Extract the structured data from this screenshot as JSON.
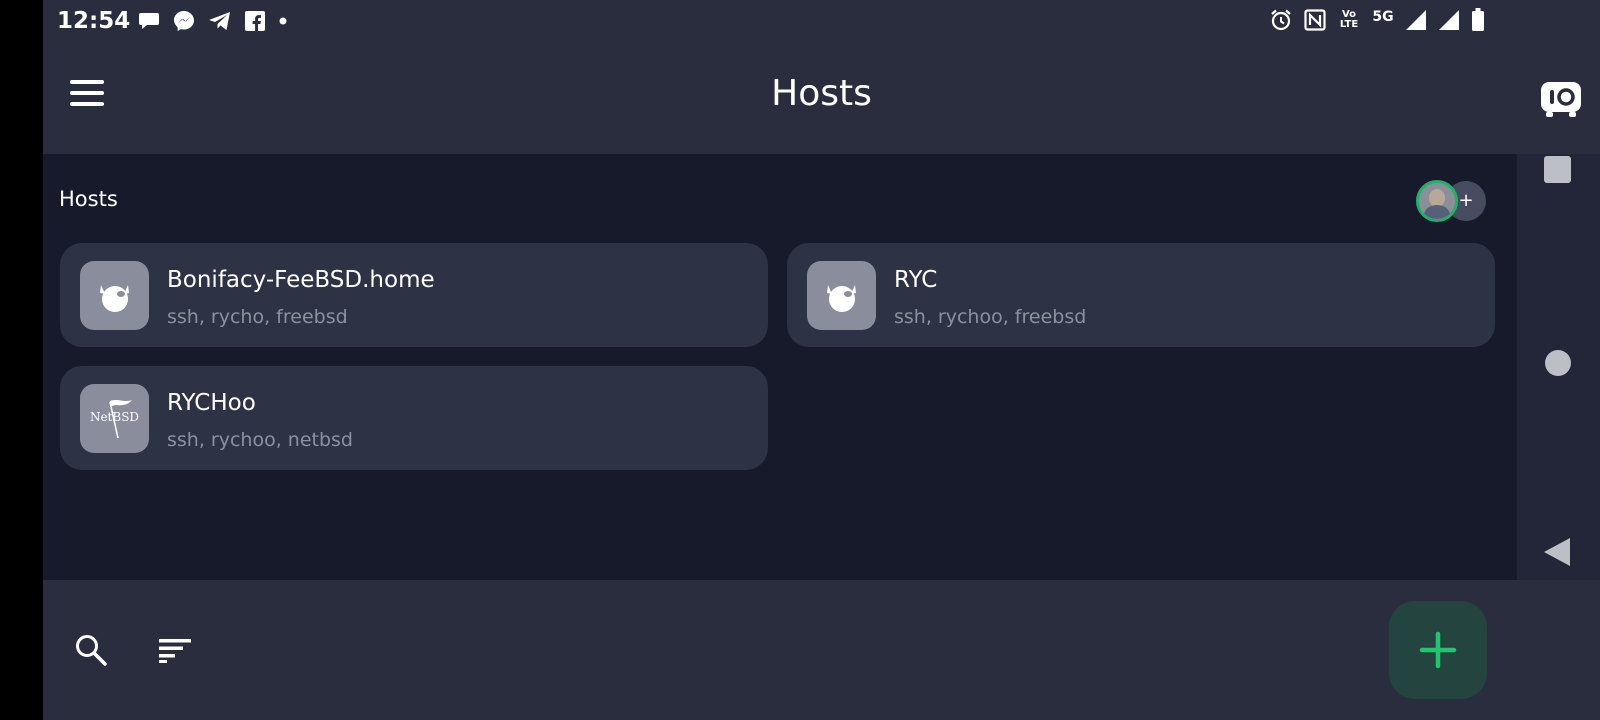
{
  "status_bar": {
    "time": "12:54",
    "left_icons": [
      "chat-bubble-icon",
      "messenger-icon",
      "telegram-icon",
      "facebook-icon",
      "dot-icon"
    ],
    "right_icons": [
      "alarm-icon",
      "nfc-icon",
      "volte-icon",
      "5g-icon",
      "signal-icon",
      "signal-icon",
      "battery-icon"
    ],
    "volte_text_top": "Vo",
    "volte_text_bottom": "LTE",
    "network_text": "5G"
  },
  "app_bar": {
    "title": "Hosts",
    "menu_icon": "hamburger-menu-icon",
    "vault_icon": "vault-icon"
  },
  "section": {
    "title": "Hosts",
    "add_member_label": "+"
  },
  "hosts": [
    {
      "name": "Bonifacy-FeeBSD.home",
      "tags": "ssh, rycho, freebsd",
      "os_icon": "freebsd-icon"
    },
    {
      "name": "RYC",
      "tags": "ssh, rychoo, freebsd",
      "os_icon": "freebsd-icon"
    },
    {
      "name": "RYCHoo",
      "tags": "ssh, rychoo, netbsd",
      "os_icon": "netbsd-icon",
      "logo_text": "NetBSD"
    }
  ],
  "bottom_bar": {
    "search_icon": "search-icon",
    "sort_icon": "sort-icon",
    "fab_icon": "plus-icon"
  },
  "colors": {
    "background": "#161a2b",
    "bars": "#2a2d3e",
    "card": "#2e3245",
    "accent_green": "#22b06a",
    "fab_bg": "#23443f",
    "muted_text": "#8c90a0"
  }
}
